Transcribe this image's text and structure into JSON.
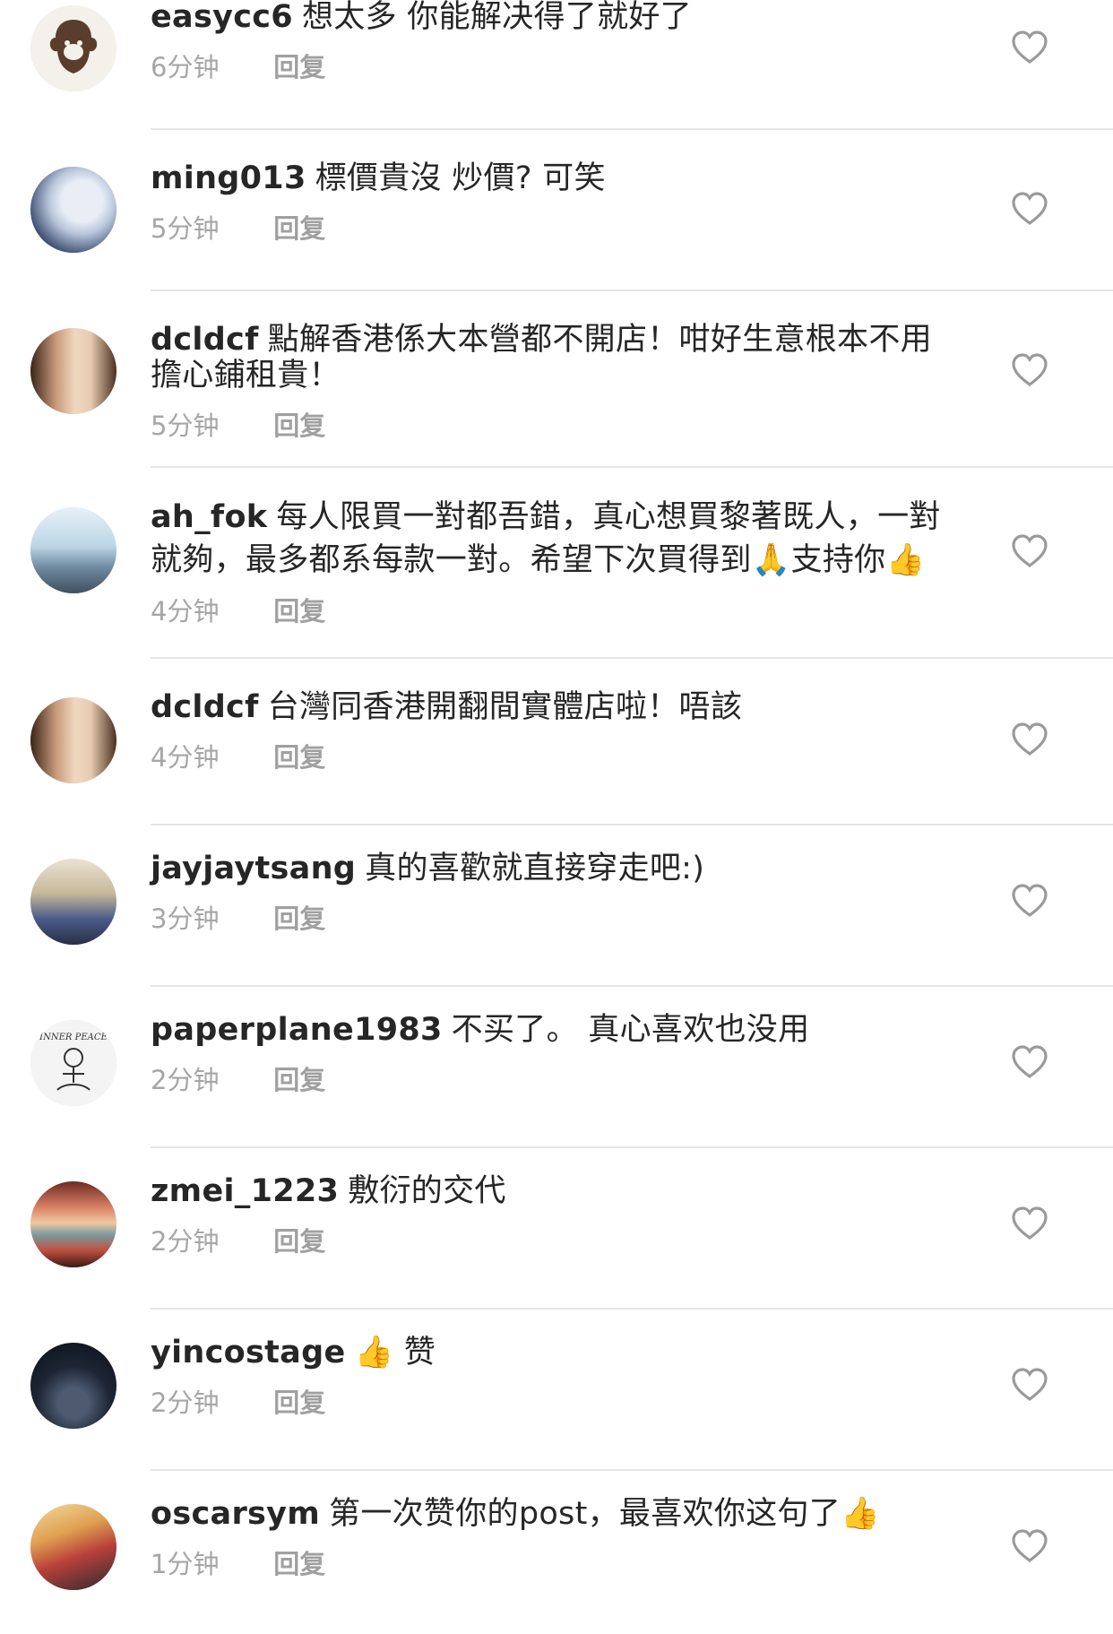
{
  "comments": [
    {
      "username": "easycc6",
      "text_line1": "想太多 你能解决得了就好了",
      "text_line2": "",
      "time": "6分钟",
      "reply": "回复",
      "avatar_icon": "bape-ape-logo-icon",
      "avatar_colors": [
        "#f3f1ea",
        "#5a3e2b"
      ]
    },
    {
      "username": "ming013",
      "text_line1": "標價貴沒 炒價?  可笑",
      "text_line2": "",
      "time": "5分钟",
      "reply": "回复",
      "avatar_icon": "photo-avatar-icon",
      "avatar_colors": [
        "#c9d4e6",
        "#23355a"
      ]
    },
    {
      "username": "dcldcf",
      "text_line1": "點解香港係大本營都不開店！咁好生意根本不用",
      "text_line2": "擔心鋪租貴！",
      "time": "5分钟",
      "reply": "回复",
      "avatar_icon": "photo-avatar-icon",
      "avatar_colors": [
        "#d8b59a",
        "#6a4630"
      ]
    },
    {
      "username": "ah_fok",
      "text_line1": "每人限買一對都吾錯，真心想買黎著既人，一對",
      "text_line2": "就夠，最多都系每款一對。希望下次買得到🙏支持你👍",
      "time": "4分钟",
      "reply": "回复",
      "avatar_icon": "photo-avatar-icon",
      "avatar_colors": [
        "#c4dbe8",
        "#5a6e80"
      ]
    },
    {
      "username": "dcldcf",
      "text_line1": "台灣同香港開翻間實體店啦！唔該",
      "text_line2": "",
      "time": "4分钟",
      "reply": "回复",
      "avatar_icon": "photo-avatar-icon",
      "avatar_colors": [
        "#d8b59a",
        "#6a4630"
      ]
    },
    {
      "username": "jayjaytsang",
      "text_line1": "真的喜歡就直接穿走吧:)",
      "text_line2": "",
      "time": "3分钟",
      "reply": "回复",
      "avatar_icon": "photo-avatar-icon",
      "avatar_colors": [
        "#b7c3a8",
        "#3a3f5a"
      ]
    },
    {
      "username": "paperplane1983",
      "text_line1": "不买了。 真心喜欢也没用",
      "text_line2": "",
      "time": "2分钟",
      "reply": "回复",
      "avatar_icon": "inner-peace-drawing-icon",
      "avatar_colors": [
        "#f4f4f4",
        "#333333"
      ]
    },
    {
      "username": "zmei_1223",
      "text_line1": "敷衍的交代",
      "text_line2": "",
      "time": "2分钟",
      "reply": "回复",
      "avatar_icon": "photo-avatar-icon",
      "avatar_colors": [
        "#d9a38a",
        "#7a3a2a"
      ]
    },
    {
      "username": "yincostage",
      "text_line1": "👍 赞",
      "text_line2": "",
      "time": "2分钟",
      "reply": "回复",
      "avatar_icon": "photo-avatar-icon",
      "avatar_colors": [
        "#2f3a4d",
        "#0e1420"
      ]
    },
    {
      "username": "oscarsym",
      "text_line1": "第一次赞你的post，最喜欢你这句了👍",
      "text_line2": "",
      "time": "1分钟",
      "reply": "回复",
      "avatar_icon": "photo-avatar-icon",
      "avatar_colors": [
        "#e2b66a",
        "#8a3a2a"
      ]
    }
  ],
  "icons": {
    "like": "heart-outline-icon"
  },
  "colors": {
    "username": "#262626",
    "text": "#262626",
    "meta": "#a6a6a6",
    "divider": "#e6e6e6",
    "heart": "#9a9a9a"
  }
}
